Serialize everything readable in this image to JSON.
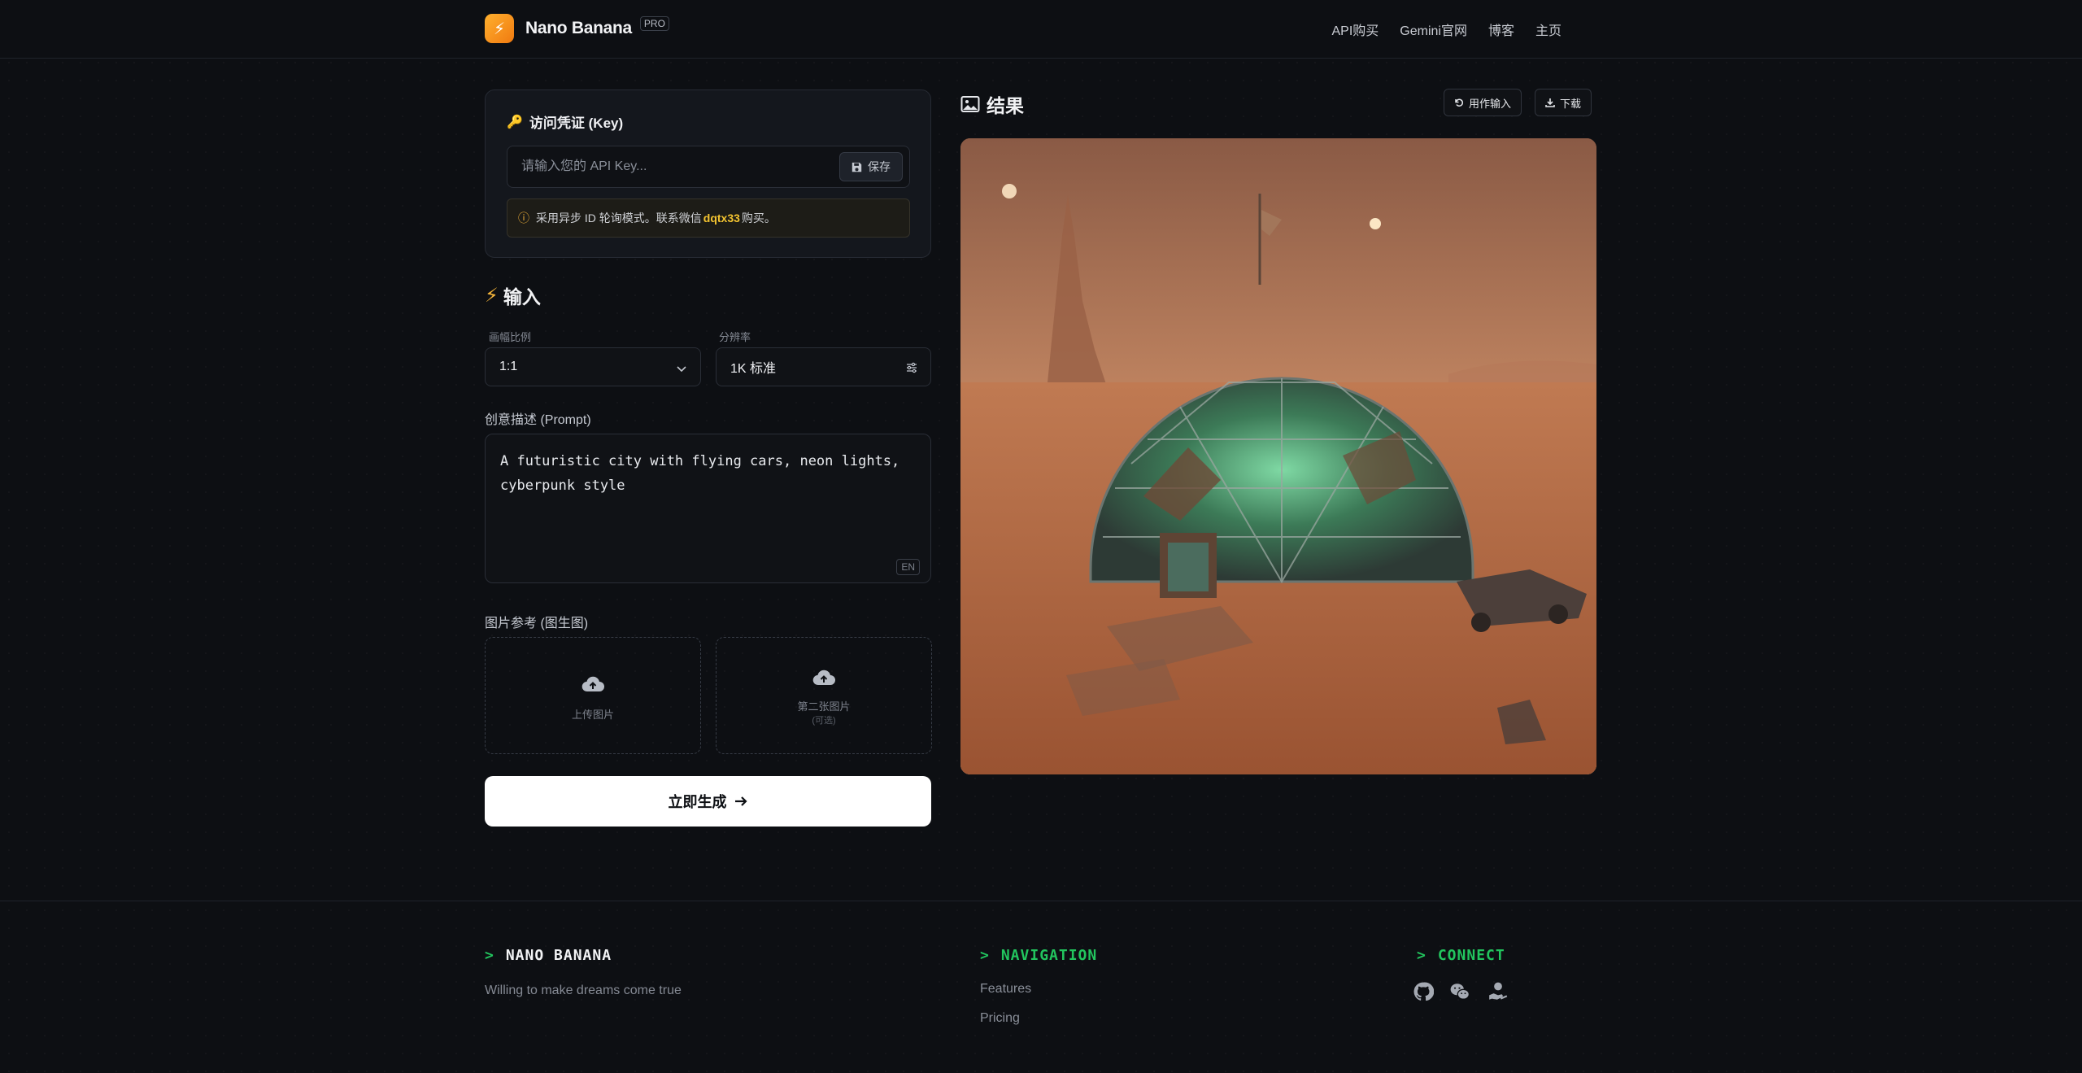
{
  "header": {
    "brand_name": "Nano Banana",
    "brand_badge": "PRO",
    "nav": [
      "API购买",
      "Gemini官网",
      "博客",
      "主页"
    ]
  },
  "key_card": {
    "title": "访问凭证 (Key)",
    "input_placeholder": "请输入您的 API Key...",
    "save_label": "保存",
    "notice_before": "采用异步 ID 轮询模式。联系微信",
    "notice_contact": "dqtx33",
    "notice_after": "购买。"
  },
  "input_section": {
    "heading": "输入",
    "aspect_label": "画幅比例",
    "aspect_value": "1:1",
    "resolution_label": "分辨率",
    "resolution_value": "1K 标准",
    "prompt_label": "创意描述 (Prompt)",
    "prompt_value": "A futuristic city with flying cars, neon lights, cyberpunk style",
    "prompt_lang": "EN",
    "ref_label": "图片参考 (图生图)",
    "upload_1": "上传图片",
    "upload_2": "第二张图片",
    "upload_2_sub": "(可选)",
    "generate_label": "立即生成"
  },
  "result": {
    "heading": "结果",
    "use_as_input": "用作输入",
    "download": "下载"
  },
  "footer": {
    "brand": "NANO BANANA",
    "tagline": "Willing to make dreams come true",
    "nav_heading": "NAVIGATION",
    "nav_links": [
      "Features",
      "Pricing"
    ],
    "connect_heading": "CONNECT",
    "prompt_symbol": ">"
  },
  "colors": {
    "accent": "#f4b43a",
    "terminal_green": "#22c55e",
    "background": "#0d0f13"
  },
  "icons": [
    "bolt-icon",
    "key-icon",
    "floppy-icon",
    "info-icon",
    "chevron-down-icon",
    "sliders-icon",
    "cloud-upload-icon",
    "arrow-right-icon",
    "image-icon",
    "undo-icon",
    "download-icon",
    "github-icon",
    "wechat-icon",
    "donate-icon"
  ]
}
